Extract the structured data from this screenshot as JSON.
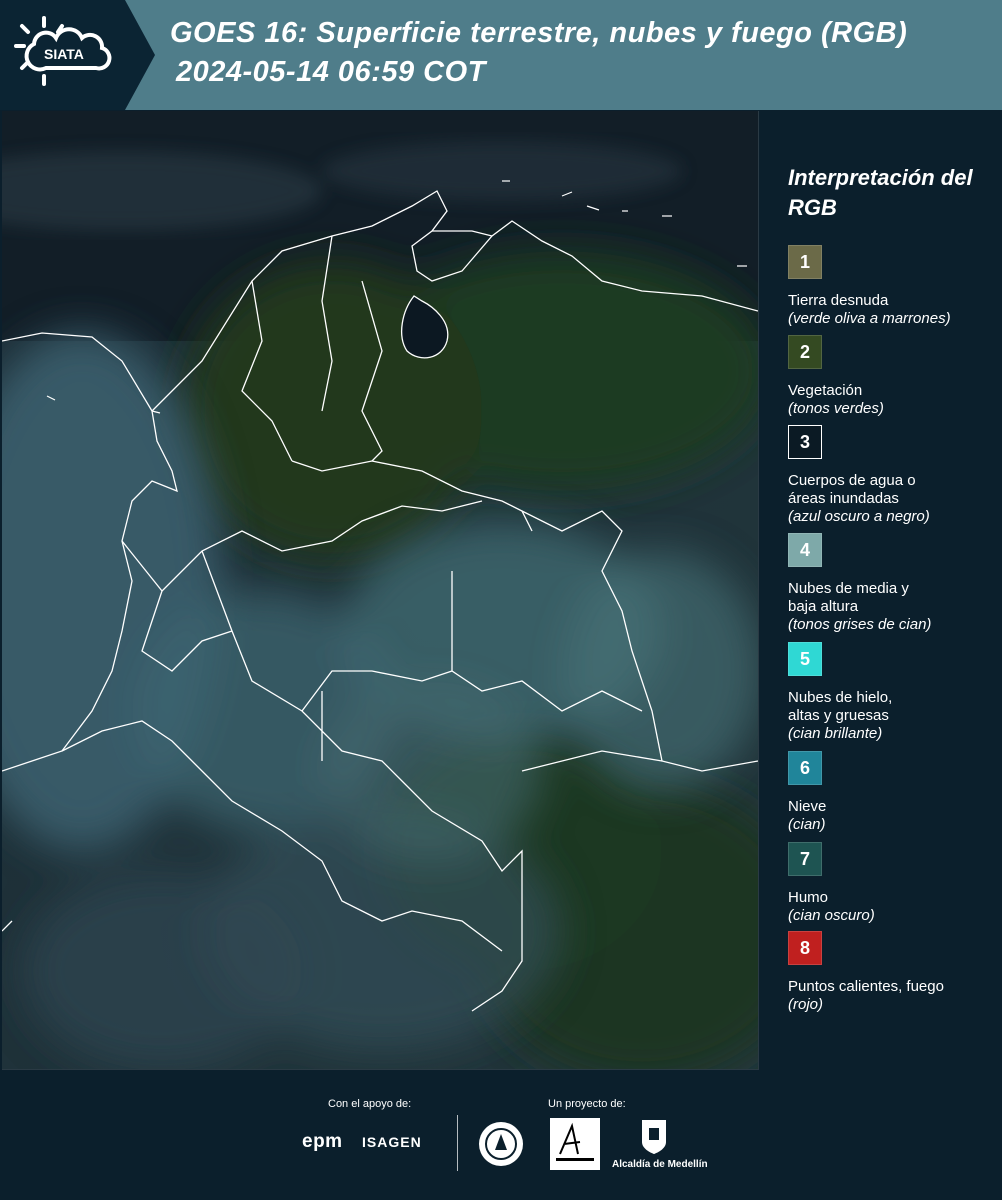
{
  "header": {
    "logo_text": "SIATA",
    "title_line1": "GOES 16: Superficie terrestre, nubes y fuego (RGB)",
    "title_line2": "2024-05-14 06:59 COT"
  },
  "legend": {
    "title": "Interpretación del RGB",
    "items": [
      {
        "number": "1",
        "color": "#6b6a48",
        "name": "Tierra desnuda",
        "desc": "(verde oliva a marrones)"
      },
      {
        "number": "2",
        "color": "#344a22",
        "name": "Vegetación",
        "desc": "(tonos verdes)"
      },
      {
        "number": "3",
        "color": "#0b1a24",
        "name": "Cuerpos de agua o\náreas inundadas",
        "desc": "(azul oscuro a negro)"
      },
      {
        "number": "4",
        "color": "#7ea9a9",
        "name": "Nubes de media y\nbaja altura",
        "desc": "(tonos grises de cian)"
      },
      {
        "number": "5",
        "color": "#2fd8d4",
        "name": "Nubes de hielo,\naltas y gruesas",
        "desc": "(cian brillante)"
      },
      {
        "number": "6",
        "color": "#20859a",
        "name": "Nieve",
        "desc": "(cian)"
      },
      {
        "number": "7",
        "color": "#1e5452",
        "name": "Humo",
        "desc": "(cian oscuro)"
      },
      {
        "number": "8",
        "color": "#c0201f",
        "name": "Puntos calientes, fuego",
        "desc": "(rojo)"
      }
    ]
  },
  "footer": {
    "support_label": "Con el apoyo de:",
    "project_label": "Un proyecto de:",
    "sponsor1": "epm",
    "sponsor2": "ISAGEN",
    "partner": "Alcaldía de Medellín"
  }
}
